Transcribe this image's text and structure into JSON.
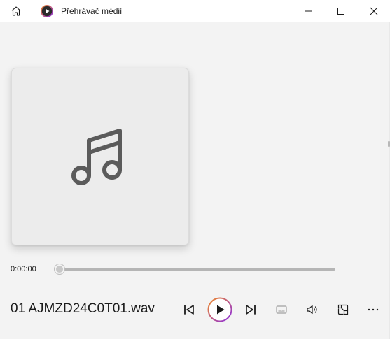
{
  "window": {
    "title": "Přehrávač médií"
  },
  "icons": {
    "home": "home-icon",
    "app": "media-player-icon",
    "minimize": "minimize-icon",
    "maximize": "maximize-icon",
    "close": "close-icon",
    "album_placeholder": "music-note-icon",
    "previous": "skip-previous-icon",
    "play": "play-icon",
    "next": "skip-next-icon",
    "subtitles": "subtitles-icon",
    "volume": "volume-icon",
    "mini_player": "mini-player-icon",
    "more": "more-options-icon"
  },
  "playback": {
    "current_time": "0:00:00",
    "progress": 0,
    "track_title": "01 AJMZD24C0T01.wav"
  },
  "colors": {
    "accent_gradient_start": "#f08a24",
    "accent_gradient_end": "#8a2be2",
    "background": "#f3f3f3",
    "titlebar": "#ffffff"
  }
}
